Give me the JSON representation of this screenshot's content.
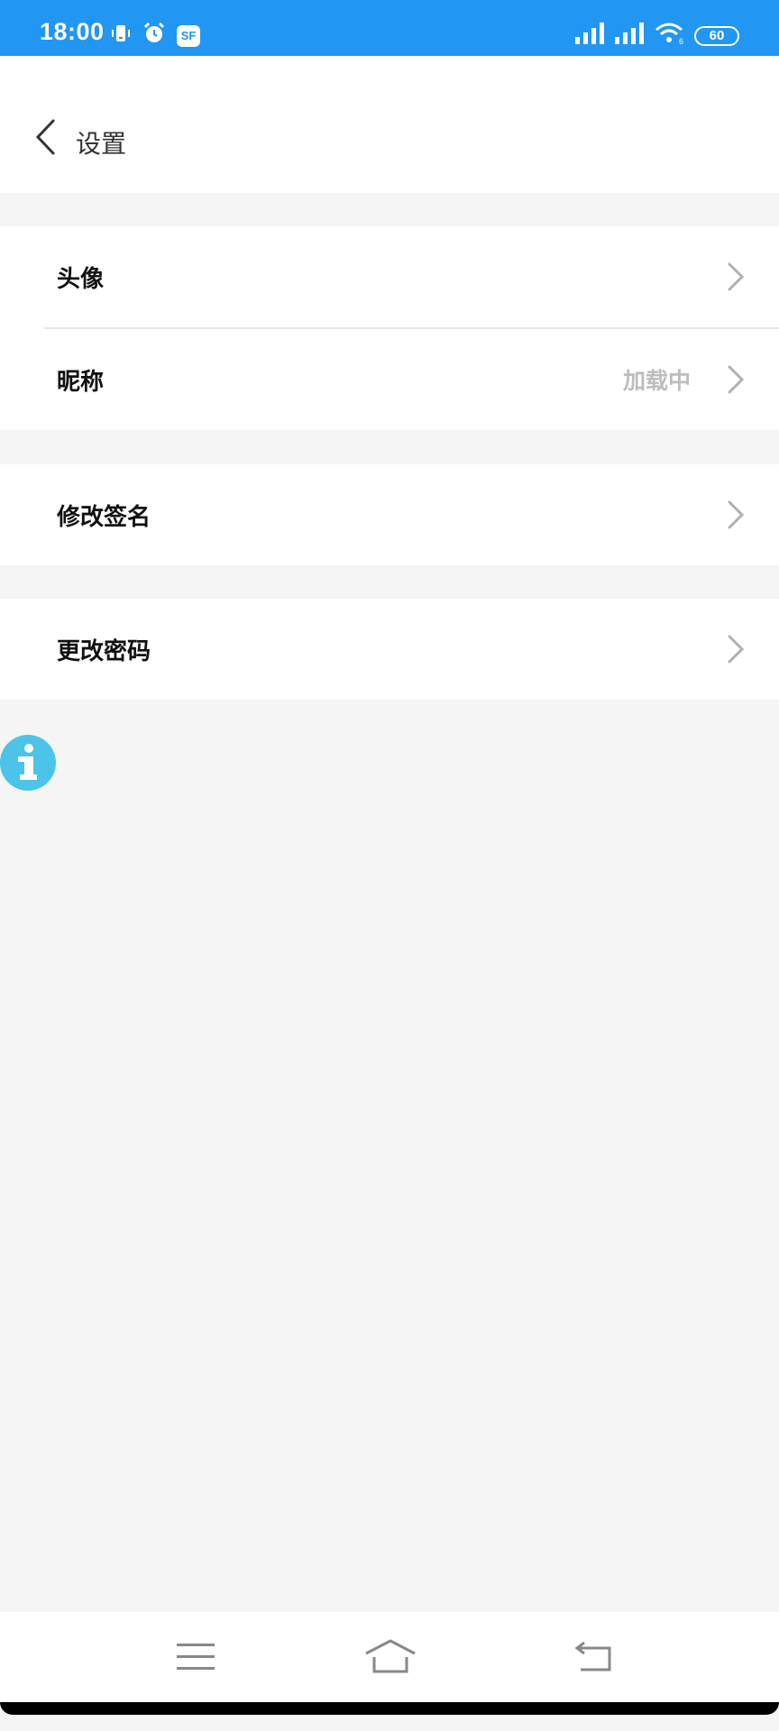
{
  "status_bar": {
    "time": "18:00",
    "sf_badge": "SF",
    "battery": "60",
    "icons": [
      "vibrate-icon",
      "alarm-icon",
      "sf-icon",
      "signal-icon",
      "signal-icon",
      "wifi-icon",
      "battery-icon"
    ],
    "bg_color": "#2196f3"
  },
  "header": {
    "title": "设置"
  },
  "groups": [
    {
      "rows": [
        {
          "label": "头像",
          "value": ""
        },
        {
          "label": "昵称",
          "value": "加载中"
        }
      ]
    },
    {
      "rows": [
        {
          "label": "修改签名",
          "value": ""
        }
      ]
    },
    {
      "rows": [
        {
          "label": "更改密码",
          "value": ""
        }
      ]
    }
  ],
  "colors": {
    "accent": "#2196f3",
    "info_fab": "#4cc3e8",
    "value_text": "#bdbdbd",
    "chevron": "#b0b0b0"
  },
  "nav_bar": {
    "buttons": [
      "menu-icon",
      "home-icon",
      "back-icon"
    ]
  }
}
